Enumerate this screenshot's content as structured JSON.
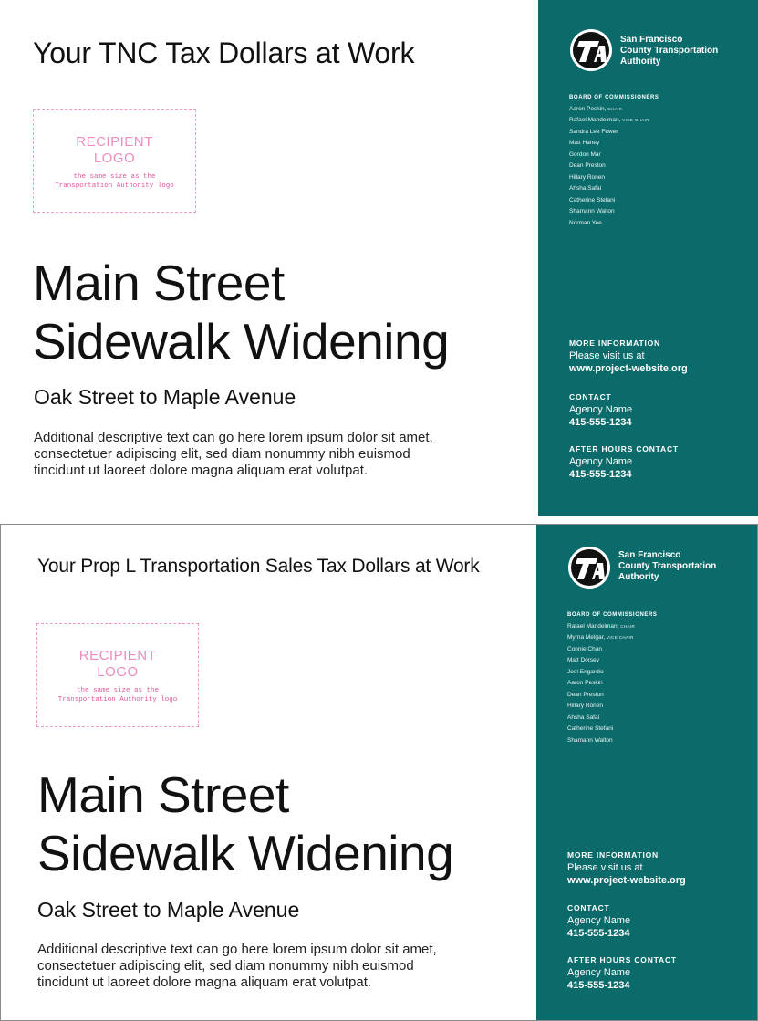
{
  "org": {
    "name_lines": [
      "San Francisco",
      "County Transportation",
      "Authority"
    ],
    "board_title": "BOARD OF COMMISSIONERS",
    "panel_color": "#0b6b6b",
    "logo_icon": "sfcta-logo-icon"
  },
  "recipient": {
    "line1": "RECIPIENT",
    "line2": "LOGO",
    "note_line1": "the same size as the",
    "note_line2": "Transportation Authority logo"
  },
  "info": {
    "more_label": "MORE INFORMATION",
    "more_text": "Please visit us at",
    "website": "www.project-website.org",
    "contact_label": "CONTACT",
    "agency": "Agency Name",
    "phone": "415-555-1234",
    "after_label": "AFTER HOURS CONTACT",
    "after_agency": "Agency Name",
    "after_phone": "415-555-1234"
  },
  "signs": [
    {
      "headline": "Your TNC Tax Dollars at Work",
      "project_line1": "Main Street",
      "project_line2": "Sidewalk Widening",
      "subhead": "Oak Street to Maple Avenue",
      "desc_lines": [
        "Additional descriptive text can go here lorem ipsum dolor sit amet,",
        "consectetuer adipiscing elit, sed diam nonummy nibh euismod",
        "tincidunt ut laoreet dolore magna aliquam erat volutpat."
      ],
      "board": [
        {
          "name": "Aaron Peskin,",
          "role": "CHAIR"
        },
        {
          "name": "Rafael Mandelman,",
          "role": "VICE CHAIR"
        },
        {
          "name": "Sandra Lee Fewer",
          "role": ""
        },
        {
          "name": "Matt Haney",
          "role": ""
        },
        {
          "name": "Gordon Mar",
          "role": ""
        },
        {
          "name": "Dean Preston",
          "role": ""
        },
        {
          "name": "Hillary Ronen",
          "role": ""
        },
        {
          "name": "Ahsha Safaí",
          "role": ""
        },
        {
          "name": "Catherine Stefani",
          "role": ""
        },
        {
          "name": "Shamann Walton",
          "role": ""
        },
        {
          "name": "Norman Yee",
          "role": ""
        }
      ]
    },
    {
      "headline": "Your Prop L Transportation Sales Tax Dollars at Work",
      "project_line1": "Main Street",
      "project_line2": "Sidewalk Widening",
      "subhead": "Oak Street to Maple Avenue",
      "desc_lines": [
        "Additional descriptive text can go here lorem ipsum dolor sit amet,",
        "consectetuer adipiscing elit, sed diam nonummy nibh euismod",
        "tincidunt ut laoreet dolore magna aliquam erat volutpat."
      ],
      "board": [
        {
          "name": "Rafael Mandelman,",
          "role": "CHAIR"
        },
        {
          "name": "Myrna Melgar,",
          "role": "VICE CHAIR"
        },
        {
          "name": "Connie Chan",
          "role": ""
        },
        {
          "name": "Matt Dorsey",
          "role": ""
        },
        {
          "name": "Joel Engardio",
          "role": ""
        },
        {
          "name": "Aaron Peskin",
          "role": ""
        },
        {
          "name": "Dean Preston",
          "role": ""
        },
        {
          "name": "Hillary Ronen",
          "role": ""
        },
        {
          "name": "Ahsha Safaí",
          "role": ""
        },
        {
          "name": "Catherine Stefani",
          "role": ""
        },
        {
          "name": "Shamann Walton",
          "role": ""
        }
      ]
    }
  ]
}
